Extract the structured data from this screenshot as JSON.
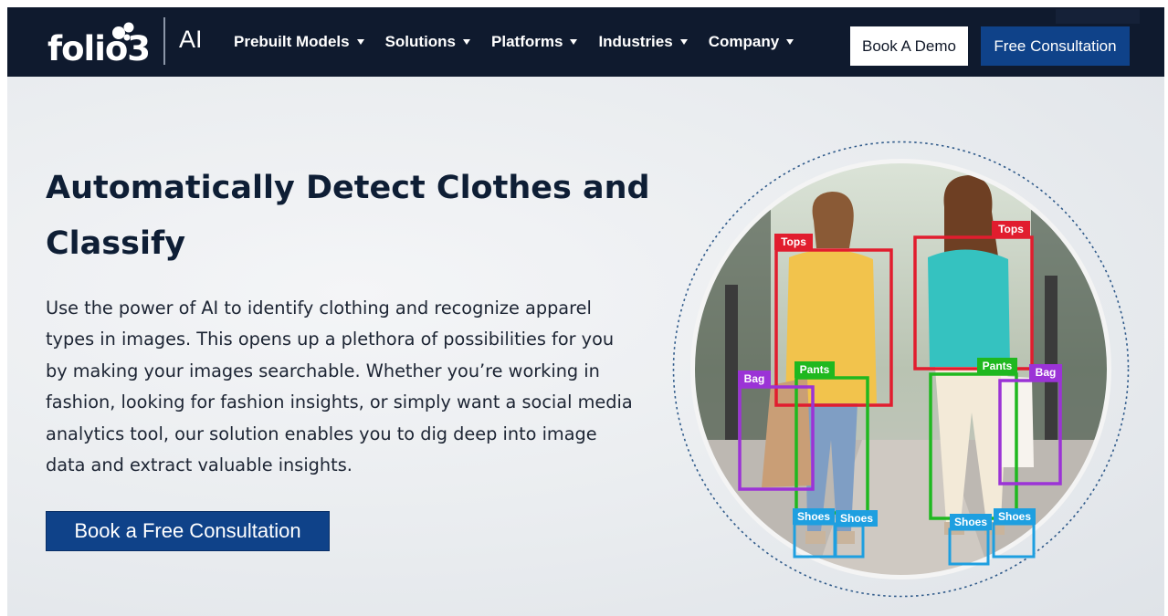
{
  "brand": {
    "logo_text": "folio3",
    "logo_suffix": "AI"
  },
  "nav": {
    "items": [
      {
        "label": "Prebuilt Models"
      },
      {
        "label": "Solutions"
      },
      {
        "label": "Platforms"
      },
      {
        "label": "Industries"
      },
      {
        "label": "Company"
      }
    ],
    "demo_button": "Book A Demo",
    "consult_button": "Free Consultation"
  },
  "hero": {
    "title": "Automatically Detect Clothes and Classify",
    "description": "Use the power of AI to identify clothing and recognize apparel types in images. This opens up a plethora of possibilities for you by making your images searchable. Whether you’re working in fashion, looking for fashion insights, or simply want a social media analytics tool, our solution enables you to dig deep into image data and extract valuable insights.",
    "cta": "Book a Free Consultation"
  },
  "detection_labels": {
    "tops": "Tops",
    "pants": "Pants",
    "bag": "Bag",
    "shoes": "Shoes"
  },
  "colors": {
    "nav_bg": "#0f1a2e",
    "brand_blue": "#0f4289",
    "tops_box": "#e11d2e",
    "pants_box": "#1fb81f",
    "bag_box": "#9b33d6",
    "shoes_box": "#1e9fe0"
  }
}
